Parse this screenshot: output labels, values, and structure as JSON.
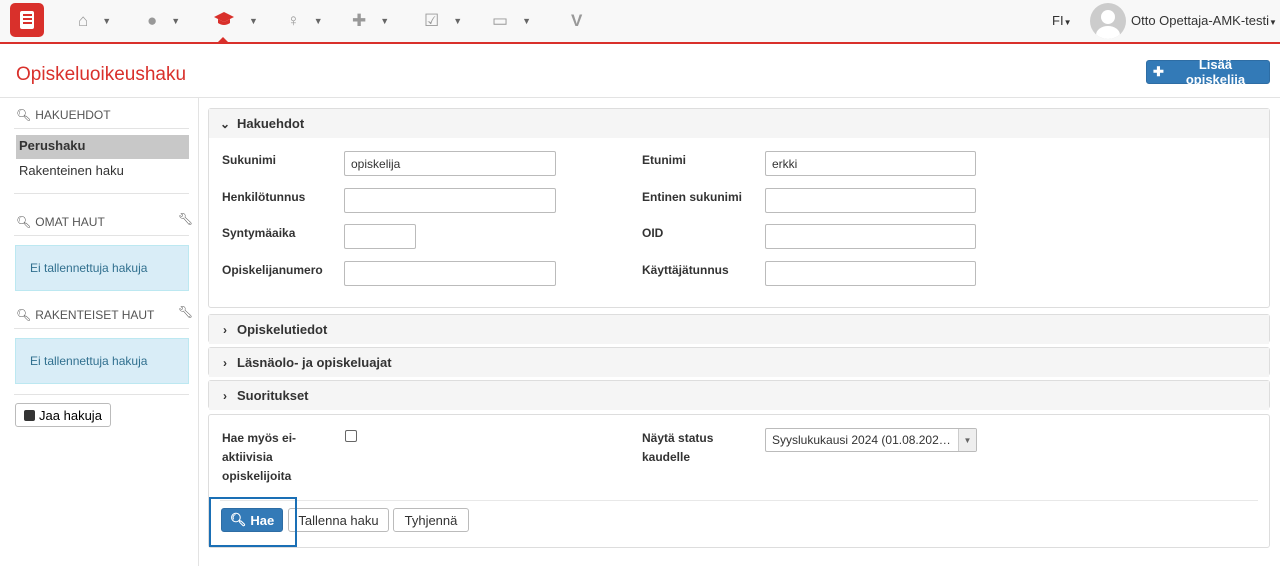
{
  "nav": {
    "items": [
      {
        "name": "home-icon"
      },
      {
        "name": "user-icon"
      },
      {
        "name": "graduation-cap-icon",
        "active": true
      },
      {
        "name": "lightbulb-icon"
      },
      {
        "name": "puzzle-icon"
      },
      {
        "name": "checkbox-icon"
      },
      {
        "name": "calendar-icon"
      },
      {
        "name": "v-icon",
        "label": "V"
      }
    ],
    "language": "FI",
    "username": "Otto Opettaja-AMK-testi",
    "accent_color": "#d9302b"
  },
  "page": {
    "title": "Opiskeluoikeushaku",
    "add_button": "Lisää opiskelija"
  },
  "sidebar": {
    "criteria_heading": "HAKUEHDOT",
    "items": [
      {
        "label": "Perushaku",
        "active": true
      },
      {
        "label": "Rakenteinen haku",
        "active": false
      }
    ],
    "own_searches_heading": "OMAT HAUT",
    "own_searches_empty": "Ei tallennettuja hakuja",
    "structured_heading": "RAKENTEISET HAUT",
    "structured_empty": "Ei tallennettuja hakuja",
    "share_button": "Jaa hakuja"
  },
  "search_panel": {
    "title": "Hakuehdot",
    "fields": {
      "sukunimi": {
        "label": "Sukunimi",
        "value": "opiskelija"
      },
      "etunimi": {
        "label": "Etunimi",
        "value": "erkki"
      },
      "henkilotunnus": {
        "label": "Henkilötunnus",
        "value": ""
      },
      "entinen_sukunimi": {
        "label": "Entinen sukunimi",
        "value": ""
      },
      "syntymaaika": {
        "label": "Syntymäaika",
        "value": ""
      },
      "oid": {
        "label": "OID",
        "value": ""
      },
      "opiskelijanumero": {
        "label": "Opiskelijanumero",
        "value": ""
      },
      "kayttajatunnus": {
        "label": "Käyttäjätunnus",
        "value": ""
      }
    }
  },
  "collapsed_panels": [
    {
      "title": "Opiskelutiedot"
    },
    {
      "title": "Läsnäolo- ja opiskeluajat"
    },
    {
      "title": "Suoritukset"
    }
  ],
  "options": {
    "inactive_label_1": "Hae myös ei-",
    "inactive_label_2": "aktiivisia",
    "inactive_label_3": "opiskelijoita",
    "inactive_checked": false,
    "status_label_1": "Näytä status",
    "status_label_2": "kaudelle",
    "status_value": "Syyslukukausi 2024 (01.08.202…"
  },
  "actions": {
    "search": "Hae",
    "save": "Tallenna haku",
    "clear": "Tyhjennä"
  }
}
